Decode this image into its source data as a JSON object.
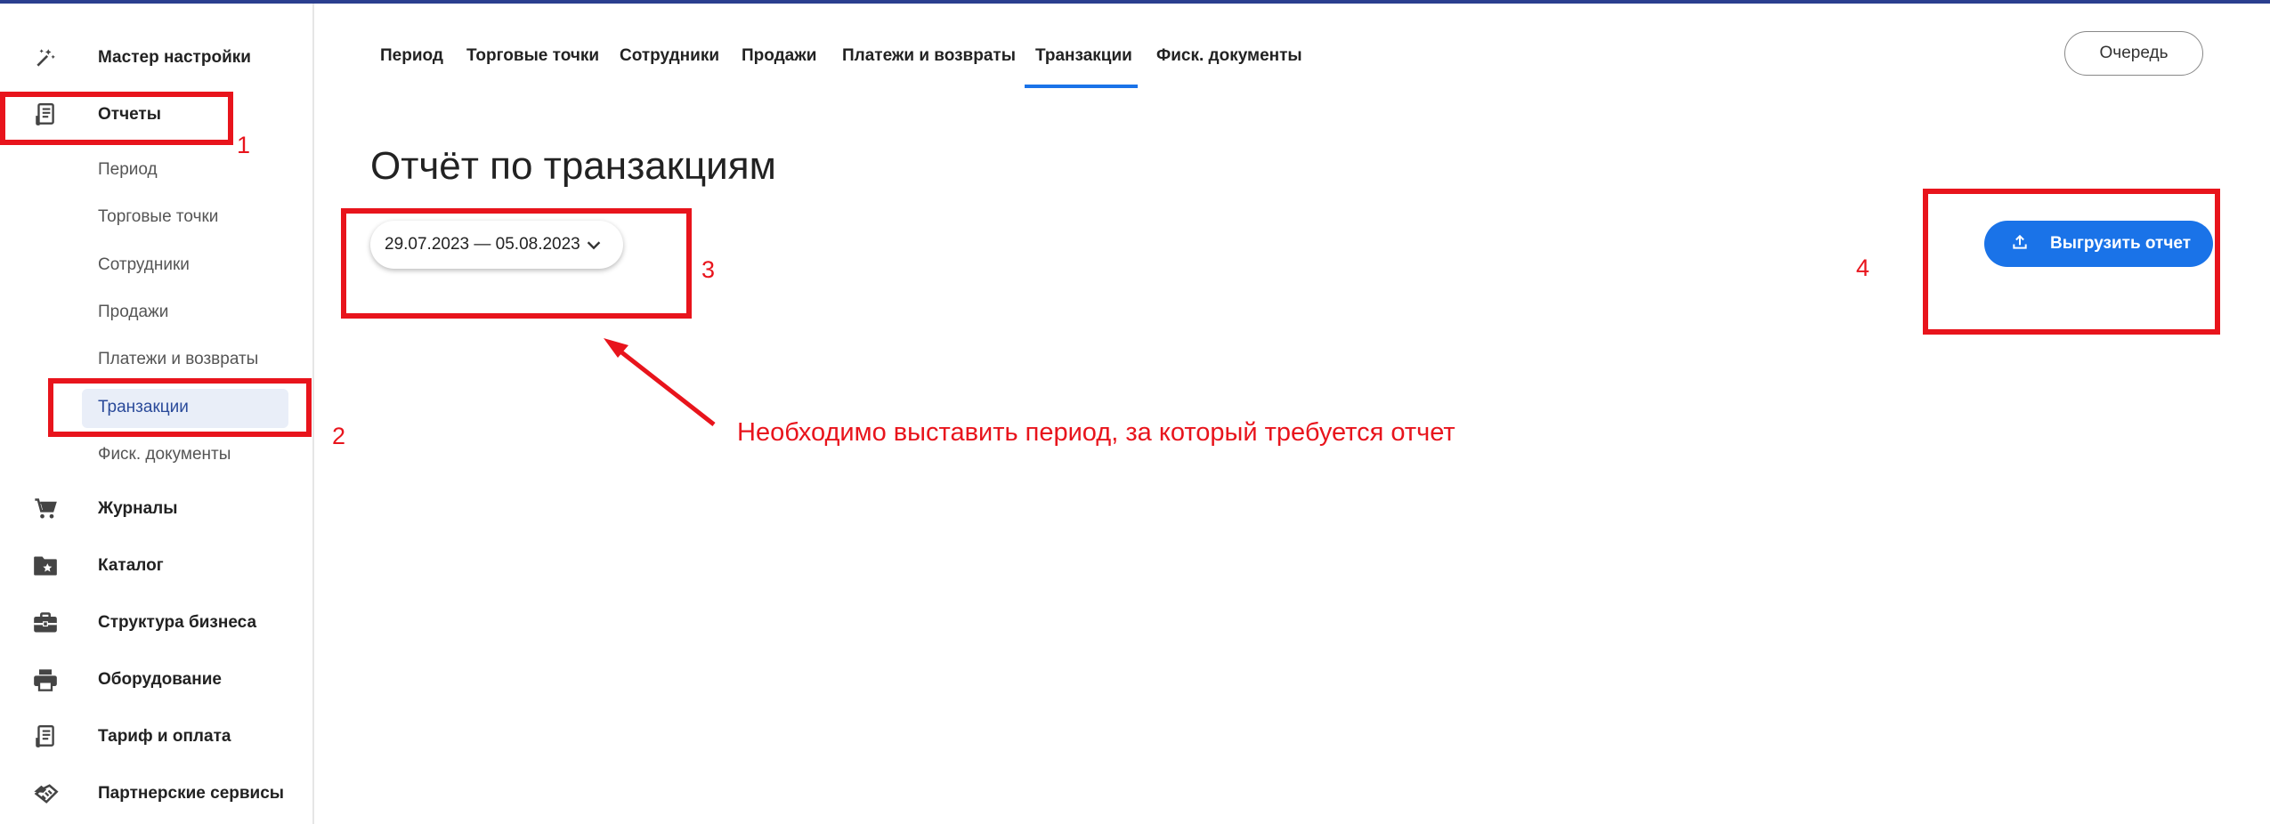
{
  "colors": {
    "accent": "#1a73e8",
    "annotation": "#e8141c",
    "active_bg": "#e9eef8"
  },
  "sidebar": {
    "items": [
      {
        "label": "Мастер настройки",
        "icon": "magic-wand-icon"
      },
      {
        "label": "Отчеты",
        "icon": "report-icon"
      },
      {
        "label": "Журналы",
        "icon": "cart-icon"
      },
      {
        "label": "Каталог",
        "icon": "folder-star-icon"
      },
      {
        "label": "Структура бизнеса",
        "icon": "briefcase-icon"
      },
      {
        "label": "Оборудование",
        "icon": "printer-icon"
      },
      {
        "label": "Тариф и оплата",
        "icon": "receipt-icon"
      },
      {
        "label": "Партнерские сервисы",
        "icon": "handshake-icon"
      }
    ],
    "report_subitems": [
      {
        "label": "Период"
      },
      {
        "label": "Торговые точки"
      },
      {
        "label": "Сотрудники"
      },
      {
        "label": "Продажи"
      },
      {
        "label": "Платежи и возвраты"
      },
      {
        "label": "Транзакции",
        "active": true
      },
      {
        "label": "Фиск. документы"
      }
    ]
  },
  "tabs": [
    {
      "label": "Период"
    },
    {
      "label": "Торговые точки"
    },
    {
      "label": "Сотрудники"
    },
    {
      "label": "Продажи"
    },
    {
      "label": "Платежи и возвраты"
    },
    {
      "label": "Транзакции",
      "active": true
    },
    {
      "label": "Фиск. документы"
    }
  ],
  "header": {
    "queue_label": "Очередь"
  },
  "main": {
    "title": "Отчёт по транзакциям",
    "date_range": "29.07.2023 — 05.08.2023",
    "export_label": "Выгрузить отчет"
  },
  "annotations": {
    "n1": "1",
    "n2": "2",
    "n3": "3",
    "n4": "4",
    "note": "Необходимо выставить период, за который требуется отчет"
  }
}
